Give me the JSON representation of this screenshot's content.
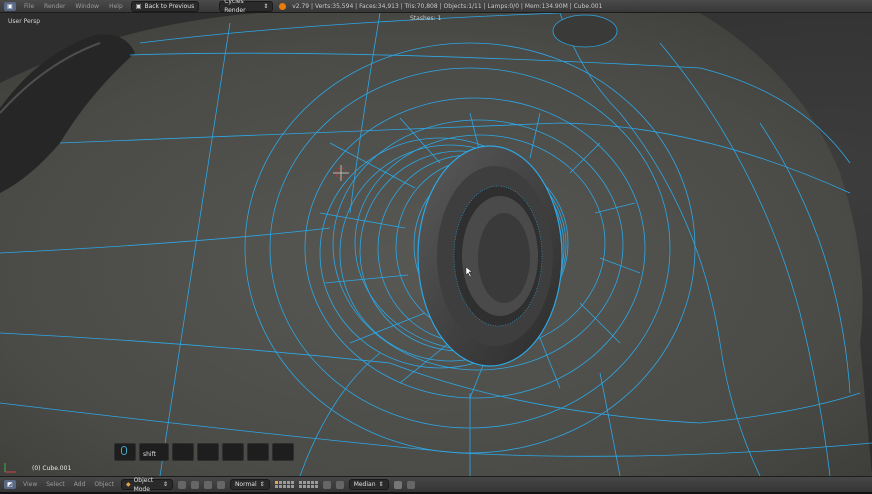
{
  "top_bar": {
    "menus": [
      "File",
      "Render",
      "Window",
      "Help"
    ],
    "back_button": "Back to Previous",
    "render_engine": "Cycles Render",
    "stats": "v2.79 | Verts:35,594 | Faces:34,913 | Tris:70,808 | Objects:1/11 | Lamps:0/0 | Mem:134.90M | Cube.001"
  },
  "viewport": {
    "view_label": "User Persp",
    "stashes_label": "Stashes:",
    "stashes_count": "1",
    "object_label": "(0) Cube.001"
  },
  "key_hud": {
    "key_label": "shift"
  },
  "bottom_bar": {
    "menus": [
      "View",
      "Select",
      "Add",
      "Object"
    ],
    "mode": "Object Mode",
    "pivot": "Normal",
    "transform": "Median"
  },
  "colors": {
    "wire": "#2da8e6",
    "surface": "#4a4a46",
    "accent": "#e87d0d"
  },
  "icons": [
    "editor-type-icon",
    "blender-logo",
    "chevron-icon",
    "mouse-icon",
    "mode-icon",
    "transform-icon",
    "layer-grid-icon",
    "snap-icon",
    "render-icon"
  ]
}
